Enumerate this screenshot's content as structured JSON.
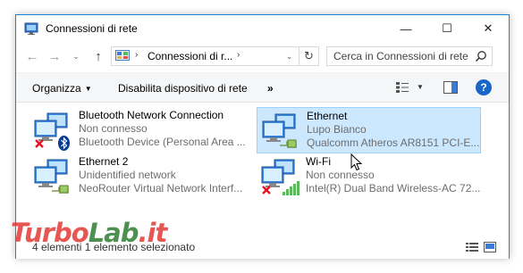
{
  "window": {
    "title": "Connessioni di rete",
    "controls": {
      "minimize": "—",
      "maximize": "☐",
      "close": "✕"
    }
  },
  "nav": {
    "back": "←",
    "forward": "→",
    "recent": "⌄",
    "up": "↑",
    "address_text": "Connessioni di r...",
    "address_chevron": "›",
    "address_chevron_2": "›",
    "address_dropdown": "⌄",
    "refresh": "↻",
    "search_placeholder": "Cerca in Connessioni di rete"
  },
  "commands": {
    "organize": "Organizza",
    "organize_caret": "▼",
    "disable_device": "Disabilita dispositivo di rete",
    "more": "»",
    "view_caret": "▼",
    "help": "?"
  },
  "connections": [
    {
      "name": "Bluetooth Network Connection",
      "status": "Non connesso",
      "device": "Bluetooth Device (Personal Area ...",
      "icon": "network-adapter-icon",
      "badge": "bluetooth-icon",
      "error": true,
      "selected": false
    },
    {
      "name": "Ethernet",
      "status": "Lupo Bianco",
      "device": "Qualcomm Atheros AR8151 PCI-E...",
      "icon": "network-adapter-icon",
      "badge": "ethernet-cable-icon",
      "error": false,
      "selected": true
    },
    {
      "name": "Ethernet 2",
      "status": "Unidentified network",
      "device": "NeoRouter Virtual Network Interf...",
      "icon": "network-adapter-icon",
      "badge": "ethernet-cable-icon",
      "error": false,
      "selected": false
    },
    {
      "name": "Wi-Fi",
      "status": "Non connesso",
      "device": "Intel(R) Dual Band Wireless-AC 72...",
      "icon": "network-adapter-icon",
      "badge": "wifi-signal-icon",
      "error": true,
      "selected": false
    }
  ],
  "statusbar": {
    "text": "4 elementi     1 elemento selezionato"
  },
  "watermark": {
    "turbo": "Turbo",
    "lab": "Lab",
    "dot": ".",
    "it": "it"
  },
  "colors": {
    "selection_bg": "#cce8ff",
    "selection_border": "#99d1ff",
    "window_border": "#1883d7",
    "help_blue": "#1866c9",
    "error_red": "#e81123"
  }
}
